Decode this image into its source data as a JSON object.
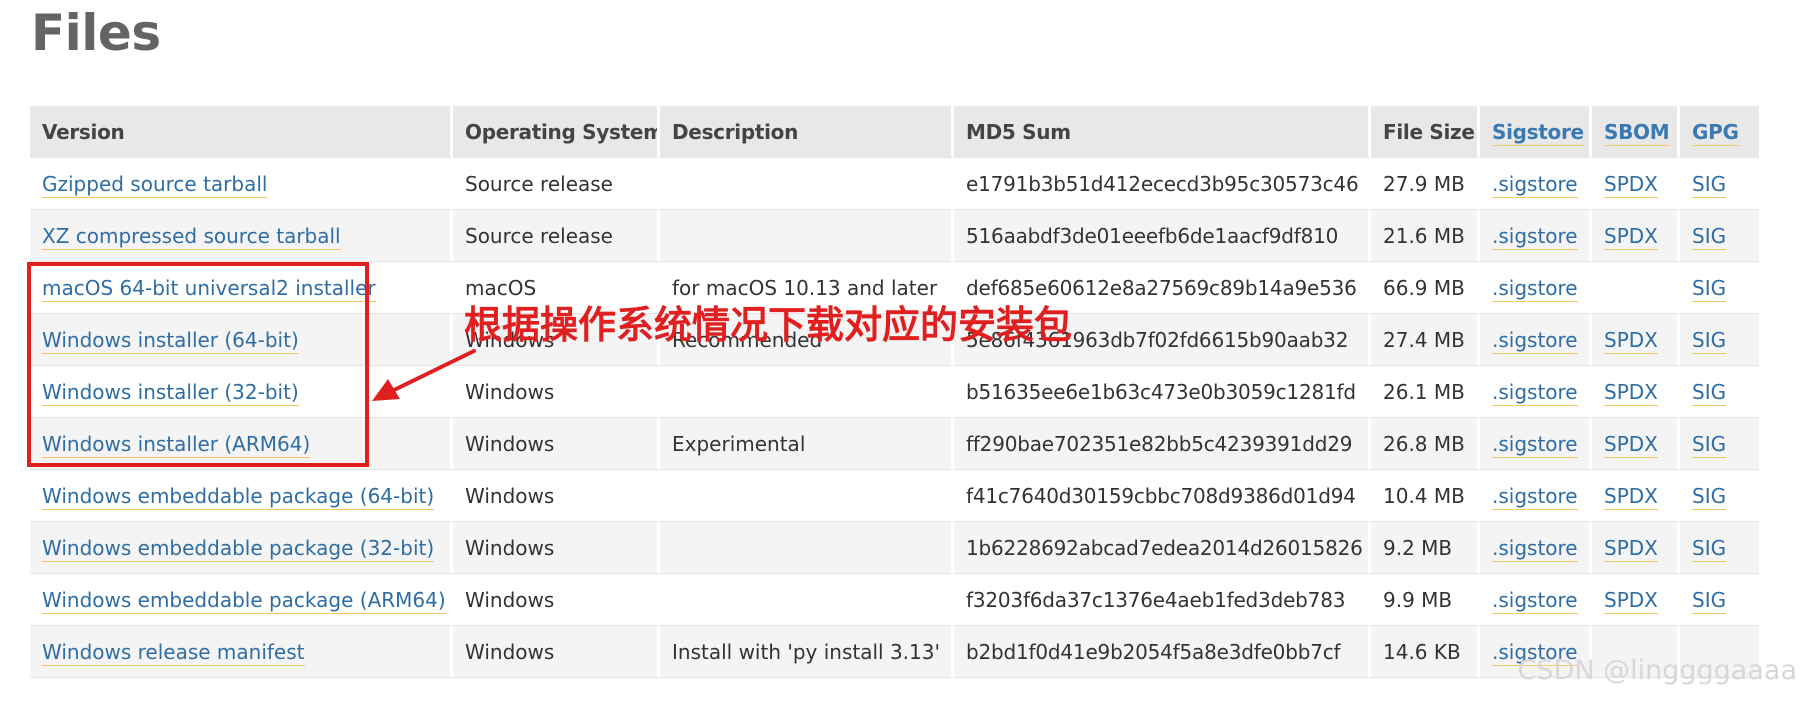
{
  "heading": "Files",
  "columns": {
    "version": "Version",
    "os": "Operating System",
    "description": "Description",
    "md5": "MD5 Sum",
    "size": "File Size",
    "sigstore": "Sigstore",
    "sbom": "SBOM",
    "gpg": "GPG"
  },
  "rows": [
    {
      "version": "Gzipped source tarball",
      "os": "Source release",
      "description": "",
      "md5": "e1791b3b51d412ececd3b95c30573c46",
      "size": "27.9 MB",
      "sigstore": ".sigstore",
      "sbom": "SPDX",
      "gpg": "SIG"
    },
    {
      "version": "XZ compressed source tarball",
      "os": "Source release",
      "description": "",
      "md5": "516aabdf3de01eeefb6de1aacf9df810",
      "size": "21.6 MB",
      "sigstore": ".sigstore",
      "sbom": "SPDX",
      "gpg": "SIG"
    },
    {
      "version": "macOS 64-bit universal2 installer",
      "os": "macOS",
      "description": "for macOS 10.13 and later",
      "md5": "def685e60612e8a27569c89b14a9e536",
      "size": "66.9 MB",
      "sigstore": ".sigstore",
      "sbom": "",
      "gpg": "SIG"
    },
    {
      "version": "Windows installer (64-bit)",
      "os": "Windows",
      "description": "Recommended",
      "md5": "5e86f4361963db7f02fd6615b90aab32",
      "size": "27.4 MB",
      "sigstore": ".sigstore",
      "sbom": "SPDX",
      "gpg": "SIG"
    },
    {
      "version": "Windows installer (32-bit)",
      "os": "Windows",
      "description": "",
      "md5": "b51635ee6e1b63c473e0b3059c1281fd",
      "size": "26.1 MB",
      "sigstore": ".sigstore",
      "sbom": "SPDX",
      "gpg": "SIG"
    },
    {
      "version": "Windows installer (ARM64)",
      "os": "Windows",
      "description": "Experimental",
      "md5": "ff290bae702351e82bb5c4239391dd29",
      "size": "26.8 MB",
      "sigstore": ".sigstore",
      "sbom": "SPDX",
      "gpg": "SIG"
    },
    {
      "version": "Windows embeddable package (64-bit)",
      "os": "Windows",
      "description": "",
      "md5": "f41c7640d30159cbbc708d9386d01d94",
      "size": "10.4 MB",
      "sigstore": ".sigstore",
      "sbom": "SPDX",
      "gpg": "SIG"
    },
    {
      "version": "Windows embeddable package (32-bit)",
      "os": "Windows",
      "description": "",
      "md5": "1b6228692abcad7edea2014d26015826",
      "size": "9.2 MB",
      "sigstore": ".sigstore",
      "sbom": "SPDX",
      "gpg": "SIG"
    },
    {
      "version": "Windows embeddable package (ARM64)",
      "os": "Windows",
      "description": "",
      "md5": "f3203f6da37c1376e4aeb1fed3deb783",
      "size": "9.9 MB",
      "sigstore": ".sigstore",
      "sbom": "SPDX",
      "gpg": "SIG"
    },
    {
      "version": "Windows release manifest",
      "os": "Windows",
      "description": "Install with 'py install 3.13'",
      "md5": "b2bd1f0d41e9b2054f5a8e3dfe0bb7cf",
      "size": "14.6 KB",
      "sigstore": ".sigstore",
      "sbom": "",
      "gpg": ""
    }
  ],
  "annotation": {
    "text": "根据操作系统情况下载对应的安装包",
    "color": "#e02020"
  },
  "watermark": "CSDN @linggggaaaa",
  "colors": {
    "link": "#2f6da3",
    "link_underline": "#f0c860",
    "header_bg": "#e8e8e8",
    "stripe_bg": "#f4f4f4",
    "heading": "#646464"
  }
}
